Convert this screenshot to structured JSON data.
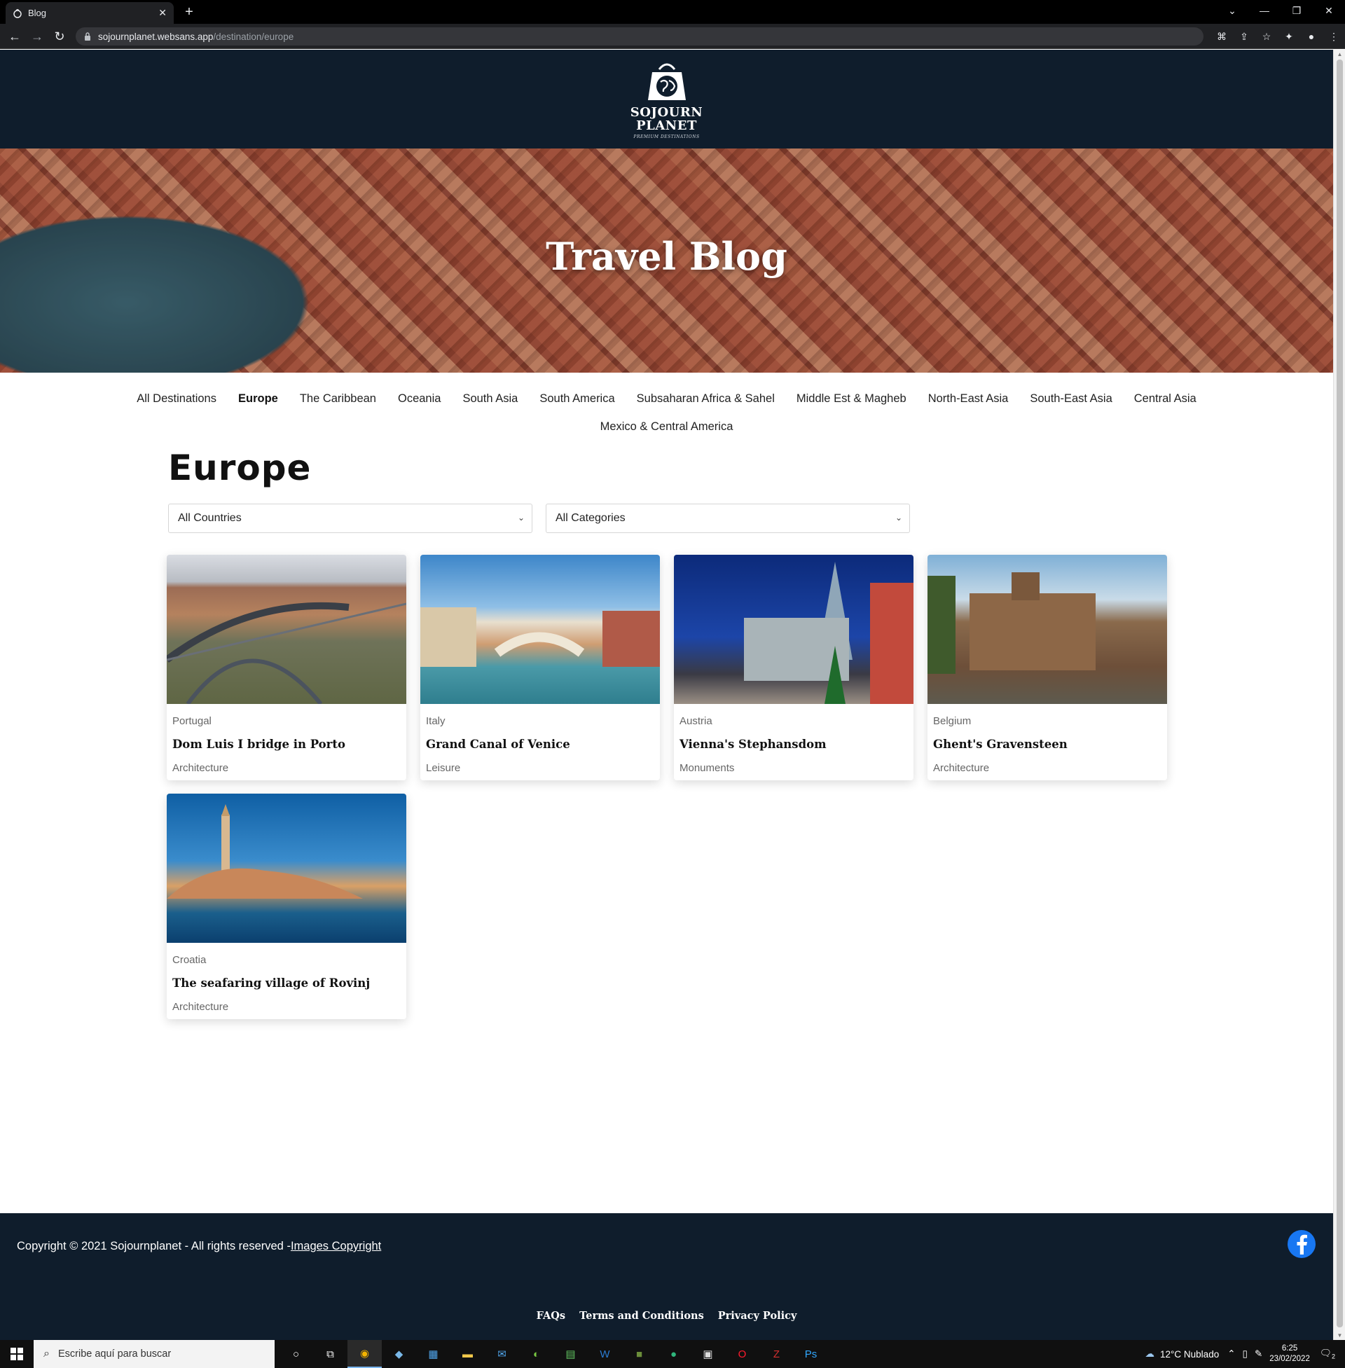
{
  "browser": {
    "tab_title": "Blog",
    "tab_close": "✕",
    "new_tab": "+",
    "url_host": "sojournplanet.websans.app",
    "url_path": "/destination/europe"
  },
  "site": {
    "logo_line1": "SOJOURN",
    "logo_line2": "PLANET",
    "logo_tagline": "PREMIUM DESTINATIONS",
    "hero_title": "Travel Blog"
  },
  "destinations": {
    "row1": [
      "All Destinations",
      "Europe",
      "The Caribbean",
      "Oceania",
      "South Asia",
      "South America",
      "Subsaharan Africa & Sahel",
      "Middle Est & Magheb",
      "North-East Asia",
      "South-East Asia",
      "Central Asia"
    ],
    "row2": [
      "Mexico & Central America"
    ],
    "active": "Europe"
  },
  "page": {
    "title": "Europe",
    "country_filter": "All Countries",
    "category_filter": "All Categories"
  },
  "posts": [
    {
      "country": "Portugal",
      "title": "Dom Luis I bridge in Porto",
      "category": "Architecture"
    },
    {
      "country": "Italy",
      "title": "Grand Canal of Venice",
      "category": "Leisure"
    },
    {
      "country": "Austria",
      "title": "Vienna's Stephansdom",
      "category": "Monuments"
    },
    {
      "country": "Belgium",
      "title": "Ghent's Gravensteen",
      "category": "Architecture"
    },
    {
      "country": "Croatia",
      "title": "The seafaring village of Rovinj",
      "category": "Architecture"
    }
  ],
  "footer": {
    "copyright": "Copyright © 2021 Sojournplanet - All rights reserved -",
    "images_copyright": "Images Copyright",
    "links": [
      "FAQs",
      "Terms and Conditions",
      "Privacy Policy"
    ]
  },
  "taskbar": {
    "search_placeholder": "Escribe aquí para buscar",
    "weather": "12°C  Nublado",
    "time": "6:25",
    "date": "23/02/2022",
    "notifications": "2"
  },
  "colors": {
    "header_bg": "#0f1d2c",
    "facebook": "#1877f2"
  }
}
